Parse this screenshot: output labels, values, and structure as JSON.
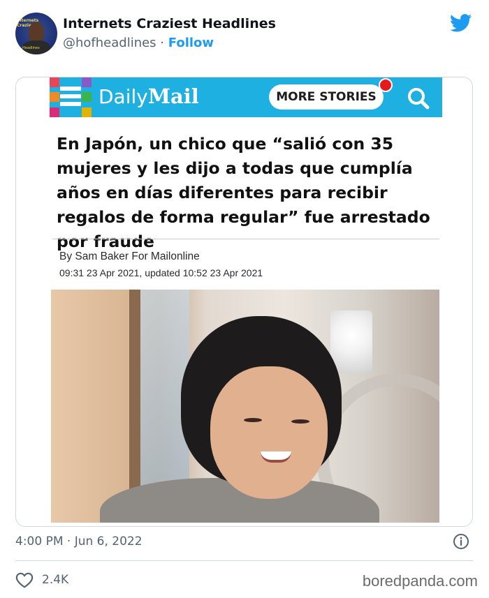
{
  "tweet": {
    "display_name": "Internets Craziest Headlines",
    "handle": "@hofheadlines",
    "separator": "·",
    "follow_label": "Follow",
    "avatar_text_top": "Internets Craziest",
    "avatar_text_bottom": "Headlines",
    "timestamp": "4:00 PM · Jun 6, 2022",
    "likes": "2.4K"
  },
  "article": {
    "brand_light": "Daily",
    "brand_bold": "Mail",
    "more_stories_label": "MORE STORIES",
    "headline": "En Japón, un chico que “salió con 35 mujeres y les dijo a todas que cumplía años en días diferentes para recibir regalos de forma regular” fue arrestado por fraude",
    "byline": "By Sam Baker For Mailonline",
    "dates": "09:31 23 Apr 2021, updated 10:52 23 Apr 2021"
  },
  "watermark": "boredpanda.com",
  "colors": {
    "brand_blue": "#1eb0e1",
    "twitter_blue": "#1d9bf0",
    "notification_red": "#e6191c",
    "muted_text": "#536471"
  },
  "icons": [
    "twitter-bird-icon",
    "menu-icon",
    "search-icon",
    "info-icon",
    "heart-icon"
  ]
}
